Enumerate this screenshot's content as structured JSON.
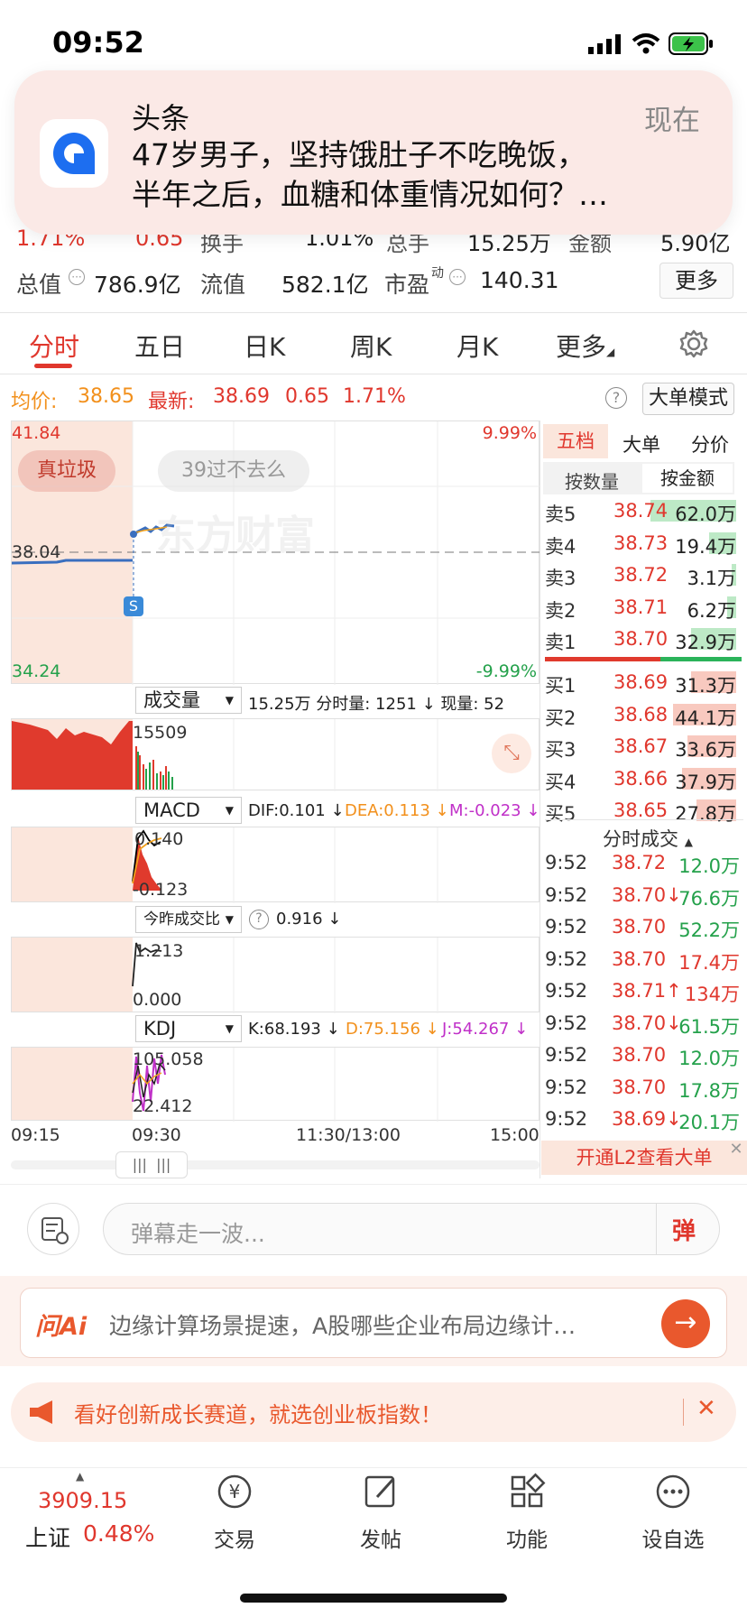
{
  "status_bar": {
    "time": "09:52"
  },
  "notification": {
    "app_name": "头条",
    "time": "现在",
    "body_line1": "47岁男子，坚持饿肚子不吃晚饭，",
    "body_line2": "半年之后，血糖和体重情况如何？…"
  },
  "quote": {
    "change_pct": "1.71%",
    "change": "0.65",
    "turnover_label": "换手",
    "turnover": "1.01%",
    "volume_label": "总手",
    "volume": "15.25万",
    "amount_label": "金额",
    "amount": "5.90亿",
    "total_value_label": "总值",
    "total_value": "786.9亿",
    "float_value_label": "流值",
    "float_value": "582.1亿",
    "pe_label": "市盈",
    "pe_sup": "动",
    "pe": "140.31",
    "more": "更多"
  },
  "tabs": [
    "分时",
    "五日",
    "日K",
    "周K",
    "月K",
    "更多"
  ],
  "info": {
    "avg_label": "均价:",
    "avg": "38.65",
    "latest_label": "最新:",
    "latest": "38.69",
    "change": "0.65",
    "change_pct": "1.71%",
    "big_order_mode": "大单模式"
  },
  "chart": {
    "y_top": "41.84",
    "y_mid": "38.04",
    "y_bottom": "34.24",
    "pct_top": "9.99%",
    "pct_bottom": "-9.99%",
    "watermark": "东方财富",
    "danmu1": "真垃圾",
    "danmu2": "39过不去么",
    "s_marker": "S",
    "volume_selector": "成交量",
    "volume_info": "15.25万 分时量: 1251 ↓ 现量: 52",
    "volume_max": "15509",
    "macd_selector": "MACD",
    "dif": "DIF:0.101 ↓",
    "dea": "DEA:0.113 ↓",
    "m": "M:-0.023 ↓",
    "macd_top": "0.140",
    "macd_bottom": "-0.123",
    "ratio_selector": "今昨成交比",
    "ratio_value": "0.916 ↓",
    "ratio_top": "1.213",
    "ratio_bottom": "0.000",
    "kdj_selector": "KDJ",
    "k": "K:68.193 ↓",
    "d": "D:75.156 ↓",
    "j": "J:54.267 ↓",
    "kdj_top": "105.058",
    "kdj_bottom": "22.412",
    "x_labels": [
      "09:15",
      "09:30",
      "11:30/13:00",
      "15:00"
    ]
  },
  "side_panel": {
    "tabs": [
      "五档",
      "大单",
      "分价"
    ],
    "subtabs": [
      "按数量",
      "按金额"
    ],
    "asks": [
      {
        "label": "卖5",
        "price": "38.74",
        "amount": "62.0万",
        "fill": 0.95
      },
      {
        "label": "卖4",
        "price": "38.73",
        "amount": "19.4万",
        "fill": 0.3
      },
      {
        "label": "卖3",
        "price": "38.72",
        "amount": "3.1万",
        "fill": 0.05
      },
      {
        "label": "卖2",
        "price": "38.71",
        "amount": "6.2万",
        "fill": 0.1
      },
      {
        "label": "卖1",
        "price": "38.70",
        "amount": "32.9万",
        "fill": 0.5
      }
    ],
    "bids": [
      {
        "label": "买1",
        "price": "38.69",
        "amount": "31.3万",
        "fill": 0.5
      },
      {
        "label": "买2",
        "price": "38.68",
        "amount": "44.1万",
        "fill": 0.7
      },
      {
        "label": "买3",
        "price": "38.67",
        "amount": "33.6万",
        "fill": 0.54
      },
      {
        "label": "买4",
        "price": "38.66",
        "amount": "37.9万",
        "fill": 0.6
      },
      {
        "label": "买5",
        "price": "38.65",
        "amount": "27.8万",
        "fill": 0.44
      }
    ],
    "ratio": {
      "buy": 0.6,
      "sell": 0.4
    },
    "trades_title": "分时成交",
    "trades": [
      {
        "time": "9:52",
        "price": "38.72",
        "dir": "",
        "amount": "12.0万",
        "pc": "red",
        "ac": "green"
      },
      {
        "time": "9:52",
        "price": "38.70",
        "dir": "↓",
        "amount": "76.6万",
        "pc": "red",
        "ac": "green"
      },
      {
        "time": "9:52",
        "price": "38.70",
        "dir": "",
        "amount": "52.2万",
        "pc": "red",
        "ac": "green"
      },
      {
        "time": "9:52",
        "price": "38.70",
        "dir": "",
        "amount": "17.4万",
        "pc": "red",
        "ac": "red"
      },
      {
        "time": "9:52",
        "price": "38.71",
        "dir": "↑",
        "amount": "134万",
        "pc": "red",
        "ac": "red"
      },
      {
        "time": "9:52",
        "price": "38.70",
        "dir": "↓",
        "amount": "61.5万",
        "pc": "red",
        "ac": "green"
      },
      {
        "time": "9:52",
        "price": "38.70",
        "dir": "",
        "amount": "12.0万",
        "pc": "red",
        "ac": "green"
      },
      {
        "time": "9:52",
        "price": "38.70",
        "dir": "",
        "amount": "17.8万",
        "pc": "red",
        "ac": "green"
      },
      {
        "time": "9:52",
        "price": "38.69",
        "dir": "↓",
        "amount": "20.1万",
        "pc": "red",
        "ac": "green"
      }
    ],
    "l2_banner": "开通L2查看大单"
  },
  "comment": {
    "placeholder": "弹幕走一波...",
    "danmu_btn": "弹"
  },
  "ai": {
    "logo": "问Ai",
    "text": "边缘计算场景提速，A股哪些企业布局边缘计…"
  },
  "ad": {
    "text": "看好创新成长赛道，就选创业板指数！"
  },
  "bottom_nav": {
    "index_value": "3909.15",
    "index_name": "上证",
    "index_pct": "0.48%",
    "items": [
      {
        "label": "交易",
        "icon": "yen-circle-icon"
      },
      {
        "label": "发帖",
        "icon": "edit-icon"
      },
      {
        "label": "功能",
        "icon": "grid-icon"
      },
      {
        "label": "设自选",
        "icon": "more-circle-icon"
      }
    ]
  },
  "colors": {
    "red": "#e0372d",
    "green": "#24a14b",
    "orange": "#f2901c",
    "shade": "#fbe6dc"
  }
}
